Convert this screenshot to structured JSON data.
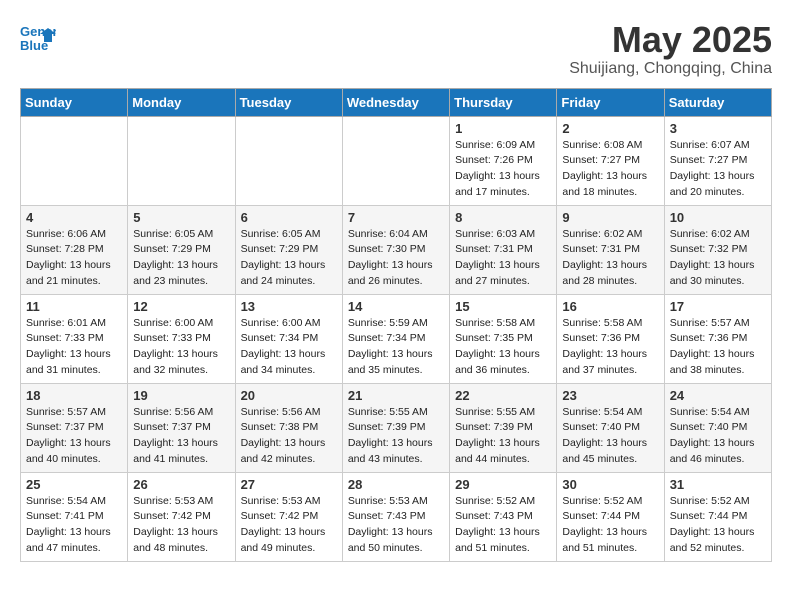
{
  "logo": {
    "line1": "General",
    "line2": "Blue"
  },
  "title": "May 2025",
  "location": "Shuijiang, Chongqing, China",
  "days_of_week": [
    "Sunday",
    "Monday",
    "Tuesday",
    "Wednesday",
    "Thursday",
    "Friday",
    "Saturday"
  ],
  "weeks": [
    [
      {
        "num": "",
        "info": ""
      },
      {
        "num": "",
        "info": ""
      },
      {
        "num": "",
        "info": ""
      },
      {
        "num": "",
        "info": ""
      },
      {
        "num": "1",
        "info": "Sunrise: 6:09 AM\nSunset: 7:26 PM\nDaylight: 13 hours\nand 17 minutes."
      },
      {
        "num": "2",
        "info": "Sunrise: 6:08 AM\nSunset: 7:27 PM\nDaylight: 13 hours\nand 18 minutes."
      },
      {
        "num": "3",
        "info": "Sunrise: 6:07 AM\nSunset: 7:27 PM\nDaylight: 13 hours\nand 20 minutes."
      }
    ],
    [
      {
        "num": "4",
        "info": "Sunrise: 6:06 AM\nSunset: 7:28 PM\nDaylight: 13 hours\nand 21 minutes."
      },
      {
        "num": "5",
        "info": "Sunrise: 6:05 AM\nSunset: 7:29 PM\nDaylight: 13 hours\nand 23 minutes."
      },
      {
        "num": "6",
        "info": "Sunrise: 6:05 AM\nSunset: 7:29 PM\nDaylight: 13 hours\nand 24 minutes."
      },
      {
        "num": "7",
        "info": "Sunrise: 6:04 AM\nSunset: 7:30 PM\nDaylight: 13 hours\nand 26 minutes."
      },
      {
        "num": "8",
        "info": "Sunrise: 6:03 AM\nSunset: 7:31 PM\nDaylight: 13 hours\nand 27 minutes."
      },
      {
        "num": "9",
        "info": "Sunrise: 6:02 AM\nSunset: 7:31 PM\nDaylight: 13 hours\nand 28 minutes."
      },
      {
        "num": "10",
        "info": "Sunrise: 6:02 AM\nSunset: 7:32 PM\nDaylight: 13 hours\nand 30 minutes."
      }
    ],
    [
      {
        "num": "11",
        "info": "Sunrise: 6:01 AM\nSunset: 7:33 PM\nDaylight: 13 hours\nand 31 minutes."
      },
      {
        "num": "12",
        "info": "Sunrise: 6:00 AM\nSunset: 7:33 PM\nDaylight: 13 hours\nand 32 minutes."
      },
      {
        "num": "13",
        "info": "Sunrise: 6:00 AM\nSunset: 7:34 PM\nDaylight: 13 hours\nand 34 minutes."
      },
      {
        "num": "14",
        "info": "Sunrise: 5:59 AM\nSunset: 7:34 PM\nDaylight: 13 hours\nand 35 minutes."
      },
      {
        "num": "15",
        "info": "Sunrise: 5:58 AM\nSunset: 7:35 PM\nDaylight: 13 hours\nand 36 minutes."
      },
      {
        "num": "16",
        "info": "Sunrise: 5:58 AM\nSunset: 7:36 PM\nDaylight: 13 hours\nand 37 minutes."
      },
      {
        "num": "17",
        "info": "Sunrise: 5:57 AM\nSunset: 7:36 PM\nDaylight: 13 hours\nand 38 minutes."
      }
    ],
    [
      {
        "num": "18",
        "info": "Sunrise: 5:57 AM\nSunset: 7:37 PM\nDaylight: 13 hours\nand 40 minutes."
      },
      {
        "num": "19",
        "info": "Sunrise: 5:56 AM\nSunset: 7:37 PM\nDaylight: 13 hours\nand 41 minutes."
      },
      {
        "num": "20",
        "info": "Sunrise: 5:56 AM\nSunset: 7:38 PM\nDaylight: 13 hours\nand 42 minutes."
      },
      {
        "num": "21",
        "info": "Sunrise: 5:55 AM\nSunset: 7:39 PM\nDaylight: 13 hours\nand 43 minutes."
      },
      {
        "num": "22",
        "info": "Sunrise: 5:55 AM\nSunset: 7:39 PM\nDaylight: 13 hours\nand 44 minutes."
      },
      {
        "num": "23",
        "info": "Sunrise: 5:54 AM\nSunset: 7:40 PM\nDaylight: 13 hours\nand 45 minutes."
      },
      {
        "num": "24",
        "info": "Sunrise: 5:54 AM\nSunset: 7:40 PM\nDaylight: 13 hours\nand 46 minutes."
      }
    ],
    [
      {
        "num": "25",
        "info": "Sunrise: 5:54 AM\nSunset: 7:41 PM\nDaylight: 13 hours\nand 47 minutes."
      },
      {
        "num": "26",
        "info": "Sunrise: 5:53 AM\nSunset: 7:42 PM\nDaylight: 13 hours\nand 48 minutes."
      },
      {
        "num": "27",
        "info": "Sunrise: 5:53 AM\nSunset: 7:42 PM\nDaylight: 13 hours\nand 49 minutes."
      },
      {
        "num": "28",
        "info": "Sunrise: 5:53 AM\nSunset: 7:43 PM\nDaylight: 13 hours\nand 50 minutes."
      },
      {
        "num": "29",
        "info": "Sunrise: 5:52 AM\nSunset: 7:43 PM\nDaylight: 13 hours\nand 51 minutes."
      },
      {
        "num": "30",
        "info": "Sunrise: 5:52 AM\nSunset: 7:44 PM\nDaylight: 13 hours\nand 51 minutes."
      },
      {
        "num": "31",
        "info": "Sunrise: 5:52 AM\nSunset: 7:44 PM\nDaylight: 13 hours\nand 52 minutes."
      }
    ]
  ]
}
